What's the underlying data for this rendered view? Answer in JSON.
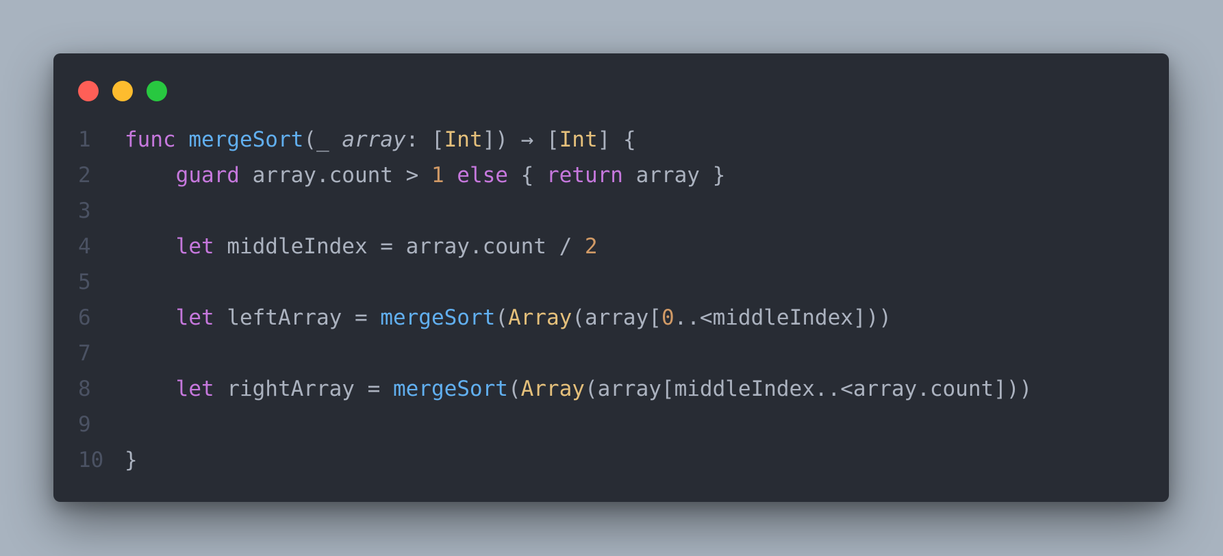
{
  "window": {
    "controls": {
      "close_color": "#ff5f57",
      "minimize_color": "#febc2e",
      "zoom_color": "#28c840"
    }
  },
  "editor": {
    "language": "swift",
    "lines": [
      {
        "number": "1",
        "tokens": [
          {
            "text": "func",
            "type": "kw"
          },
          {
            "text": " ",
            "type": "plain"
          },
          {
            "text": "mergeSort",
            "type": "fn"
          },
          {
            "text": "(_ ",
            "type": "plain"
          },
          {
            "text": "array",
            "type": "param"
          },
          {
            "text": ": [",
            "type": "plain"
          },
          {
            "text": "Int",
            "type": "ty"
          },
          {
            "text": "]) → [",
            "type": "plain"
          },
          {
            "text": "Int",
            "type": "ty"
          },
          {
            "text": "] {",
            "type": "plain"
          }
        ]
      },
      {
        "number": "2",
        "tokens": [
          {
            "text": "    ",
            "type": "plain"
          },
          {
            "text": "guard",
            "type": "kw"
          },
          {
            "text": " array.count > ",
            "type": "plain"
          },
          {
            "text": "1",
            "type": "num"
          },
          {
            "text": " ",
            "type": "plain"
          },
          {
            "text": "else",
            "type": "kw"
          },
          {
            "text": " { ",
            "type": "plain"
          },
          {
            "text": "return",
            "type": "kw"
          },
          {
            "text": " array }",
            "type": "plain"
          }
        ]
      },
      {
        "number": "3",
        "tokens": []
      },
      {
        "number": "4",
        "tokens": [
          {
            "text": "    ",
            "type": "plain"
          },
          {
            "text": "let",
            "type": "kw"
          },
          {
            "text": " middleIndex = array.count / ",
            "type": "plain"
          },
          {
            "text": "2",
            "type": "num"
          }
        ]
      },
      {
        "number": "5",
        "tokens": []
      },
      {
        "number": "6",
        "tokens": [
          {
            "text": "    ",
            "type": "plain"
          },
          {
            "text": "let",
            "type": "kw"
          },
          {
            "text": " leftArray = ",
            "type": "plain"
          },
          {
            "text": "mergeSort",
            "type": "fn"
          },
          {
            "text": "(",
            "type": "plain"
          },
          {
            "text": "Array",
            "type": "ty"
          },
          {
            "text": "(array[",
            "type": "plain"
          },
          {
            "text": "0",
            "type": "num"
          },
          {
            "text": "..<middleIndex]))",
            "type": "plain"
          }
        ]
      },
      {
        "number": "7",
        "tokens": []
      },
      {
        "number": "8",
        "tokens": [
          {
            "text": "    ",
            "type": "plain"
          },
          {
            "text": "let",
            "type": "kw"
          },
          {
            "text": " rightArray = ",
            "type": "plain"
          },
          {
            "text": "mergeSort",
            "type": "fn"
          },
          {
            "text": "(",
            "type": "plain"
          },
          {
            "text": "Array",
            "type": "ty"
          },
          {
            "text": "(array[middleIndex..<array.count]))",
            "type": "plain"
          }
        ]
      },
      {
        "number": "9",
        "tokens": []
      },
      {
        "number": "10",
        "tokens": [
          {
            "text": "}",
            "type": "plain"
          }
        ]
      }
    ]
  }
}
